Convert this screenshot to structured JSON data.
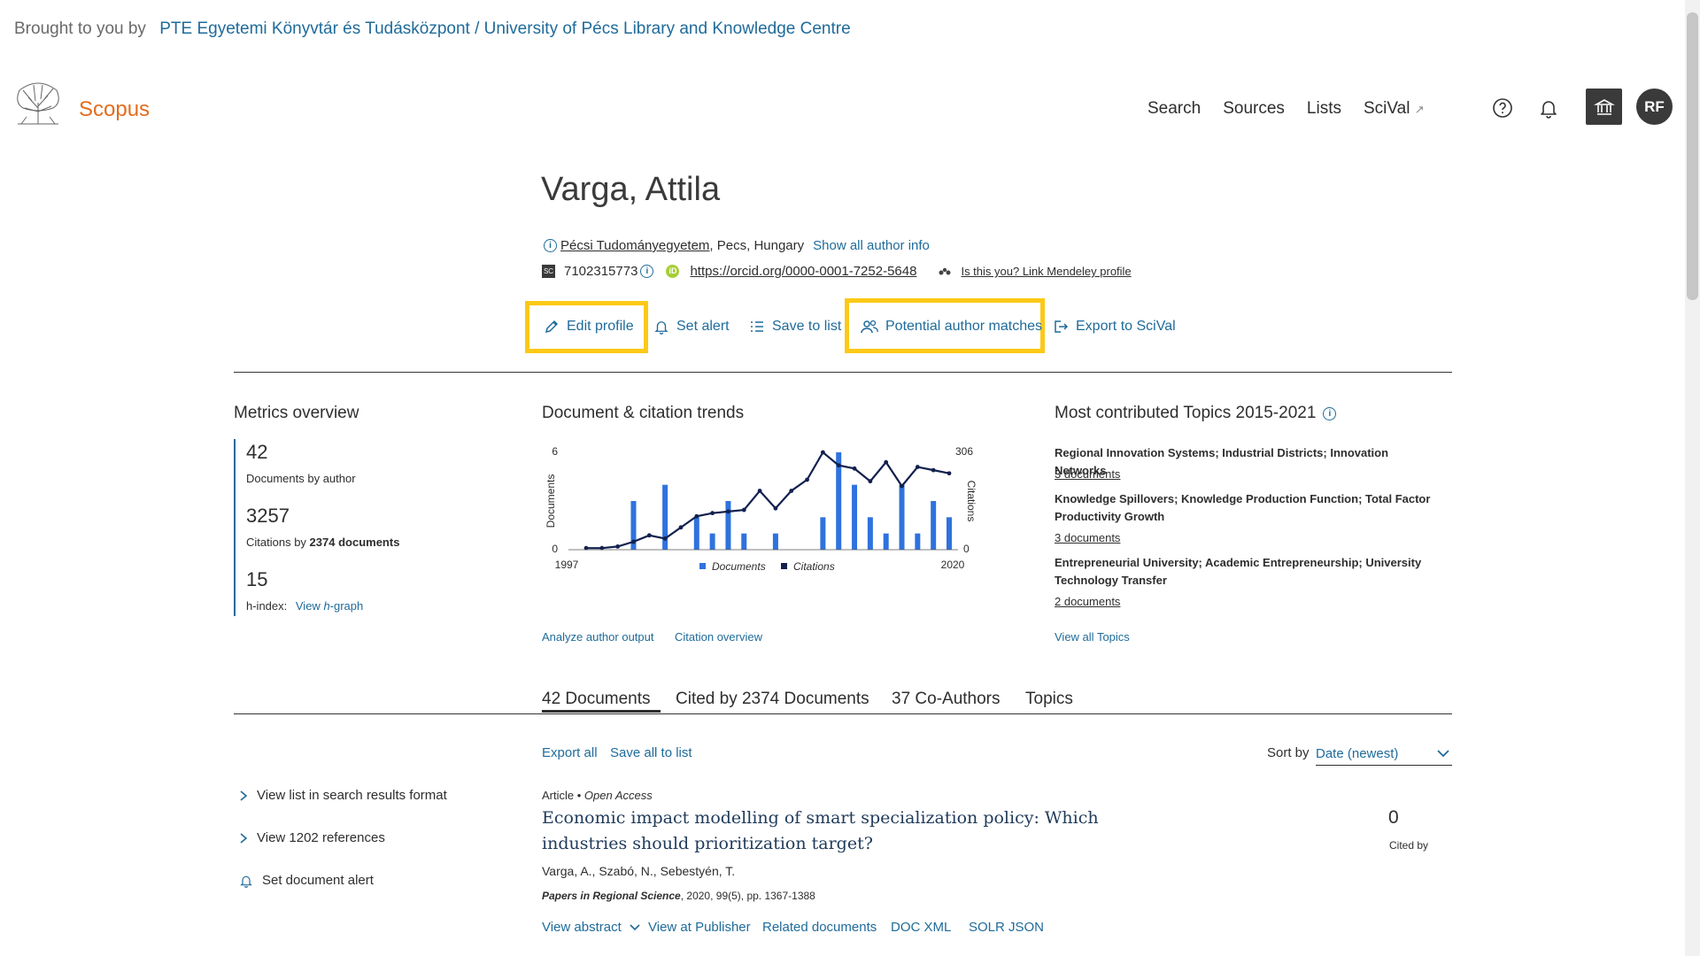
{
  "banner": {
    "prefix": "Brought to you by",
    "institution": "PTE Egyetemi Könyvtár és Tudásközpont / University of Pécs Library and Knowledge Centre"
  },
  "header": {
    "brand": "Scopus",
    "nav": [
      "Search",
      "Sources",
      "Lists",
      "SciVal"
    ],
    "nav_external_mark": "↗",
    "avatar_initials": "RF"
  },
  "author": {
    "name": "Varga, Attila",
    "affiliation": "Pécsi Tudományegyetem",
    "location": ", Pecs, Hungary",
    "show_all_info": "Show all author info",
    "scopus_badge": "SC",
    "scopus_id": "7102315773",
    "orcid_badge": "iD",
    "orcid_url": "https://orcid.org/0000-0001-7252-5648",
    "mendeley_link": "Is this you? Link Mendeley profile"
  },
  "actions": {
    "edit_profile": "Edit profile",
    "set_alert": "Set alert",
    "save_to_list": "Save to list",
    "potential_matches": "Potential author matches",
    "export_scival": "Export to SciVal"
  },
  "metrics": {
    "title": "Metrics overview",
    "documents": "42",
    "documents_label": "Documents by author",
    "citations": "3257",
    "citations_label_prefix": "Citations by ",
    "citations_label_docs": "2374 documents",
    "hindex": "15",
    "hindex_label": "h-index:",
    "hindex_link_prefix": "View ",
    "hindex_link_h": "h",
    "hindex_link_suffix": "-graph"
  },
  "trends": {
    "title": "Document & citation trends",
    "analyze_link": "Analyze author output",
    "citation_link": "Citation overview"
  },
  "chart_data": {
    "type": "bar",
    "x": [
      1997,
      1998,
      1999,
      2000,
      2001,
      2002,
      2003,
      2004,
      2005,
      2006,
      2007,
      2008,
      2009,
      2010,
      2011,
      2012,
      2013,
      2014,
      2015,
      2016,
      2017,
      2018,
      2019,
      2020
    ],
    "series": [
      {
        "name": "Documents",
        "type": "bar",
        "axis": "left",
        "values": [
          0,
          0,
          0,
          3,
          0,
          4,
          0,
          2,
          1,
          3,
          1,
          0,
          1,
          0,
          0,
          2,
          6,
          4,
          2,
          1,
          4,
          1,
          3,
          2
        ]
      },
      {
        "name": "Citations",
        "type": "line",
        "axis": "right",
        "values": [
          5,
          5,
          10,
          25,
          45,
          35,
          70,
          105,
          115,
          120,
          125,
          185,
          130,
          185,
          220,
          306,
          265,
          255,
          215,
          275,
          200,
          260,
          250,
          240
        ]
      }
    ],
    "ylabel_left": "Documents",
    "ylabel_right": "Citations",
    "ylim_left": [
      0,
      6
    ],
    "ylim_right": [
      0,
      306
    ],
    "yticks_left": [
      "0",
      "6"
    ],
    "yticks_right": [
      "0",
      "306"
    ],
    "xticks": [
      "1997",
      "2020"
    ],
    "legend_position": "bottom",
    "colors": {
      "Documents": "#2f72de",
      "Citations": "#12204f"
    }
  },
  "topics": {
    "title": "Most contributed Topics 2015-2021",
    "items": [
      {
        "name": "Regional Innovation Systems; Industrial Districts; Innovation Networks",
        "docs": "3 documents"
      },
      {
        "name": "Knowledge Spillovers; Knowledge Production Function; Total Factor Productivity Growth",
        "docs": "3 documents"
      },
      {
        "name": "Entrepreneurial University; Academic Entrepreneurship; University Technology Transfer",
        "docs": "2 documents"
      }
    ],
    "view_all": "View all Topics"
  },
  "tabs": [
    "42 Documents",
    "Cited by 2374 Documents",
    "37 Co-Authors",
    "Topics"
  ],
  "list_controls": {
    "export_all": "Export all",
    "save_all": "Save all to list",
    "sort_label": "Sort by",
    "sort_value": "Date (newest)"
  },
  "side_links": {
    "search_format": "View list in search results format",
    "references": "View 1202 references",
    "doc_alert": "Set document alert"
  },
  "document": {
    "type": "Article",
    "access": "Open Access",
    "title": "Economic impact modelling of smart specialization policy: Which industries should prioritization target?",
    "authors": "Varga, A., Szabó, N., Sebestyén, T.",
    "journal": "Papers in Regional Science",
    "source_detail": ", 2020, 99(5), pp. 1367-1388",
    "cited_count": "0",
    "cited_label": "Cited by",
    "links": [
      "View abstract",
      "View at Publisher",
      "Related documents",
      "DOC XML",
      "SOLR JSON"
    ]
  },
  "colors": {
    "accent": "#1f6b9a",
    "brand": "#e26d1d",
    "highlight": "#fcc916"
  }
}
